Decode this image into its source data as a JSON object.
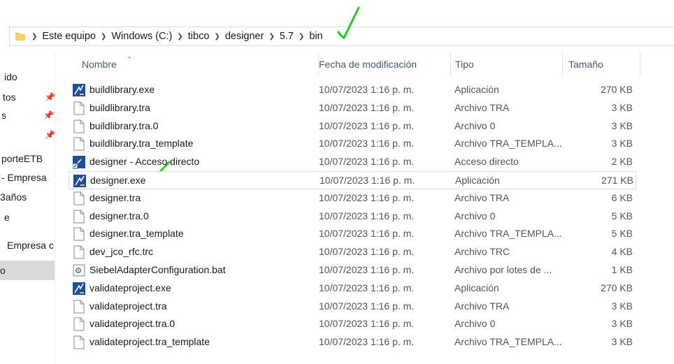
{
  "breadcrumb": [
    "Este equipo",
    "Windows (C:)",
    "tibco",
    "designer",
    "5.7",
    "bin"
  ],
  "nav": {
    "items": [
      {
        "label": "ido",
        "pinned": false
      },
      {
        "label": "tos",
        "pinned": true
      },
      {
        "label": "s",
        "pinned": true
      },
      {
        "label": "",
        "pinned": true
      },
      {
        "label": "porteETB",
        "pinned": false
      },
      {
        "label": " - Empresa",
        "pinned": false
      },
      {
        "label": "3años",
        "pinned": false
      },
      {
        "label": "e",
        "pinned": false
      },
      {
        "label": "Empresa c",
        "pinned": false
      },
      {
        "label": "o",
        "pinned": false
      }
    ]
  },
  "columns": {
    "name": "Nombre",
    "date": "Fecha de modificación",
    "type": "Tipo",
    "size": "Tamaño"
  },
  "files": [
    {
      "name": "buildlibrary.exe",
      "date": "10/07/2023 1:16 p. m.",
      "type": "Aplicación",
      "size": "270 KB",
      "icon": "exe-icon"
    },
    {
      "name": "buildlibrary.tra",
      "date": "10/07/2023 1:16 p. m.",
      "type": "Archivo TRA",
      "size": "3 KB",
      "icon": "file-icon"
    },
    {
      "name": "buildlibrary.tra.0",
      "date": "10/07/2023 1:16 p. m.",
      "type": "Archivo 0",
      "size": "3 KB",
      "icon": "file-icon"
    },
    {
      "name": "buildlibrary.tra_template",
      "date": "10/07/2023 1:16 p. m.",
      "type": "Archivo TRA_TEMPLA...",
      "size": "3 KB",
      "icon": "file-icon"
    },
    {
      "name": "designer - Acceso directo",
      "date": "10/07/2023 1:16 p. m.",
      "type": "Acceso directo",
      "size": "2 KB",
      "icon": "shortcut-icon"
    },
    {
      "name": "designer.exe",
      "date": "10/07/2023 1:16 p. m.",
      "type": "Aplicación",
      "size": "271 KB",
      "icon": "exe-icon"
    },
    {
      "name": "designer.tra",
      "date": "10/07/2023 1:16 p. m.",
      "type": "Archivo TRA",
      "size": "6 KB",
      "icon": "file-icon"
    },
    {
      "name": "designer.tra.0",
      "date": "10/07/2023 1:16 p. m.",
      "type": "Archivo 0",
      "size": "5 KB",
      "icon": "file-icon"
    },
    {
      "name": "designer.tra_template",
      "date": "10/07/2023 1:16 p. m.",
      "type": "Archivo TRA_TEMPLA...",
      "size": "5 KB",
      "icon": "file-icon"
    },
    {
      "name": "dev_jco_rfc.trc",
      "date": "10/07/2023 1:16 p. m.",
      "type": "Archivo TRC",
      "size": "4 KB",
      "icon": "file-icon"
    },
    {
      "name": "SiebelAdapterConfiguration.bat",
      "date": "10/07/2023 1:16 p. m.",
      "type": "Archivo por lotes de ...",
      "size": "1 KB",
      "icon": "bat-icon"
    },
    {
      "name": "validateproject.exe",
      "date": "10/07/2023 1:16 p. m.",
      "type": "Aplicación",
      "size": "270 KB",
      "icon": "exe-icon"
    },
    {
      "name": "validateproject.tra",
      "date": "10/07/2023 1:16 p. m.",
      "type": "Archivo TRA",
      "size": "3 KB",
      "icon": "file-icon"
    },
    {
      "name": "validateproject.tra.0",
      "date": "10/07/2023 1:16 p. m.",
      "type": "Archivo 0",
      "size": "3 KB",
      "icon": "file-icon"
    },
    {
      "name": "validateproject.tra_template",
      "date": "10/07/2023 1:16 p. m.",
      "type": "Archivo TRA_TEMPLA...",
      "size": "3 KB",
      "icon": "file-icon"
    }
  ],
  "highlighted_row": 5,
  "colors": {
    "accent": "#cce4f7",
    "annotation": "#22cc22",
    "folder": "#f3c04a",
    "exe": "#1f4e9a"
  }
}
